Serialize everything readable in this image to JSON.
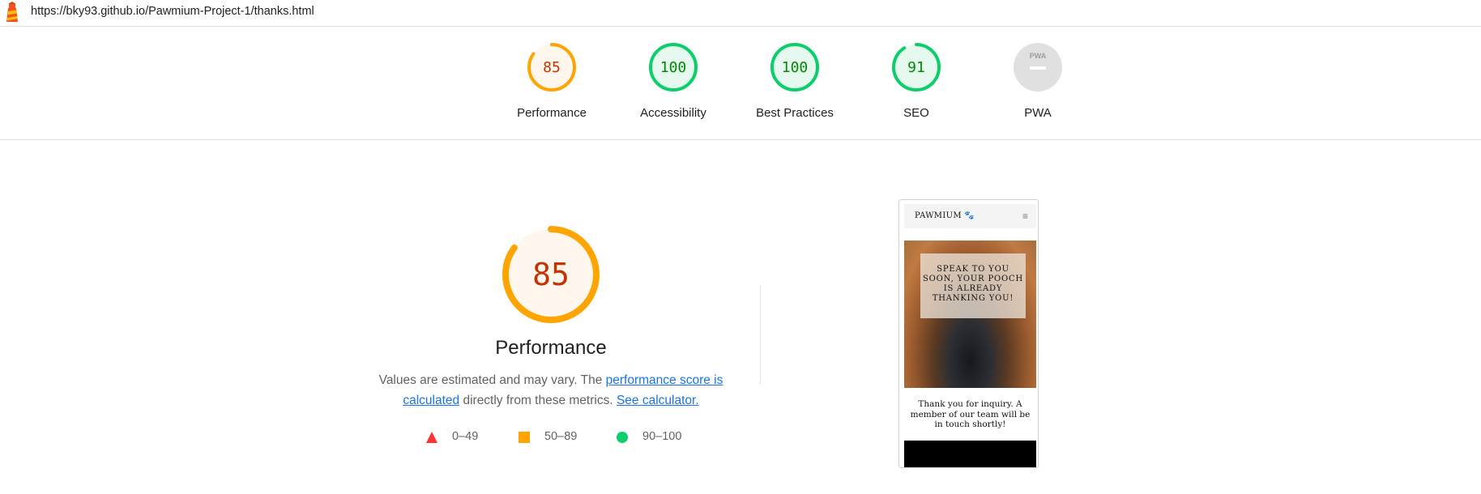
{
  "url_bar": {
    "url": "https://bky93.github.io/Pawmium-Project-1/thanks.html",
    "logo_icon": "lighthouse-icon"
  },
  "gauges": [
    {
      "label": "Performance",
      "score": "85",
      "value": 0.85,
      "rating": "average",
      "color": "#ffa400",
      "text_color": "#c33300",
      "fill": "#fff6ed"
    },
    {
      "label": "Accessibility",
      "score": "100",
      "value": 1.0,
      "rating": "pass",
      "color": "#0cce6b",
      "text_color": "#008800",
      "fill": "#e6f9ee"
    },
    {
      "label": "Best Practices",
      "score": "100",
      "value": 1.0,
      "rating": "pass",
      "color": "#0cce6b",
      "text_color": "#008800",
      "fill": "#e6f9ee"
    },
    {
      "label": "SEO",
      "score": "91",
      "value": 0.91,
      "rating": "pass",
      "color": "#0cce6b",
      "text_color": "#008800",
      "fill": "#e6f9ee"
    },
    {
      "label": "PWA",
      "score": "",
      "badge_text": "PWA",
      "value": 0,
      "rating": "na",
      "color": "#e0e0e0",
      "text_color": "#9e9e9e",
      "fill": "#e0e0e0"
    }
  ],
  "performance": {
    "score": "85",
    "value": 0.85,
    "title": "Performance",
    "desc_prefix": "Values are estimated and may vary. The ",
    "desc_link": "performance score is calculated",
    "desc_middle": " directly from these metrics. ",
    "desc_calc_link": "See calculator."
  },
  "legend": [
    {
      "range": "0–49",
      "shape": "triangle",
      "color": "#ff3333"
    },
    {
      "range": "50–89",
      "shape": "square",
      "color": "#ffa400"
    },
    {
      "range": "90–100",
      "shape": "circle",
      "color": "#0cce6b"
    }
  ],
  "screenshot": {
    "brand": "PAWMIUM",
    "brand_icon": "paw-icon",
    "menu_icon": "hamburger-icon",
    "hero_text": "SPEAK TO YOU SOON, YOUR POOCH IS ALREADY THANKING YOU!",
    "thanks_text": "Thank you for inquiry. A member of our team will be in touch shortly!"
  }
}
